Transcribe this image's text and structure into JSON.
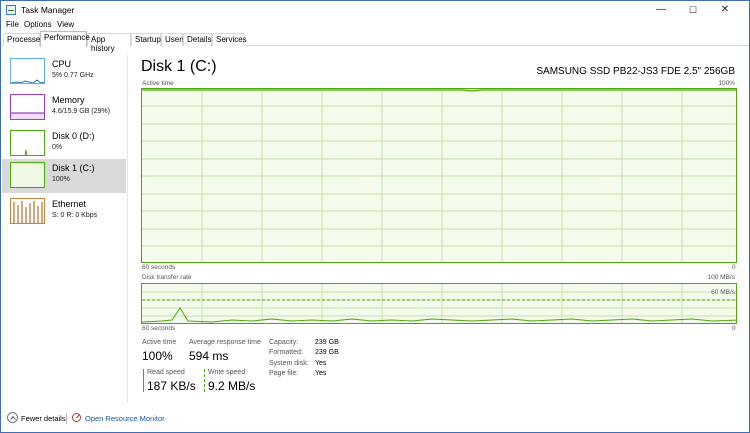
{
  "window": {
    "title": "Task Manager",
    "min_glyph": "—",
    "max_glyph": "☐",
    "close_glyph": "✕"
  },
  "menu": [
    "File",
    "Options",
    "View"
  ],
  "tabs": [
    "Processes",
    "Performance",
    "App history",
    "Startup",
    "Users",
    "Details",
    "Services"
  ],
  "active_tab": "Performance",
  "sidebar": [
    {
      "name": "CPU",
      "value": "5%  0.77 GHz",
      "color": "#1779ba"
    },
    {
      "name": "Memory",
      "value": "4.6/15.9 GB (29%)",
      "color": "#8b12ae"
    },
    {
      "name": "Disk 0 (D:)",
      "value": "0%",
      "color": "#4da60c"
    },
    {
      "name": "Disk 1 (C:)",
      "value": "100%",
      "color": "#4da60c"
    },
    {
      "name": "Ethernet",
      "value": "S: 0  R: 0 Kbps",
      "color": "#a74f01"
    }
  ],
  "main": {
    "title": "Disk 1 (C:)",
    "model": "SAMSUNG SSD PB22-JS3 FDE 2.5\" 256GB",
    "active_graph": {
      "label": "Active time",
      "max": "100%",
      "time": "60 seconds",
      "right_min": "0"
    },
    "transfer_graph": {
      "label": "Disk transfer rate",
      "max": "100 MB/s",
      "mid": "60 MB/s",
      "time": "60 seconds",
      "right_min": "0"
    }
  },
  "stats": {
    "active_time": {
      "label": "Active time",
      "value": "100%"
    },
    "avg_response": {
      "label": "Average response time",
      "value": "594 ms"
    },
    "read_speed": {
      "label": "Read speed",
      "value": "187 KB/s"
    },
    "write_speed": {
      "label": "Write speed",
      "value": "9.2 MB/s"
    },
    "details": [
      {
        "label": "Capacity:",
        "value": "239 GB"
      },
      {
        "label": "Formatted:",
        "value": "239 GB"
      },
      {
        "label": "System disk:",
        "value": "Yes"
      },
      {
        "label": "Page file:",
        "value": "Yes"
      }
    ]
  },
  "footer": {
    "fewer_details": "Fewer details",
    "open_monitor": "Open Resource Monitor"
  }
}
